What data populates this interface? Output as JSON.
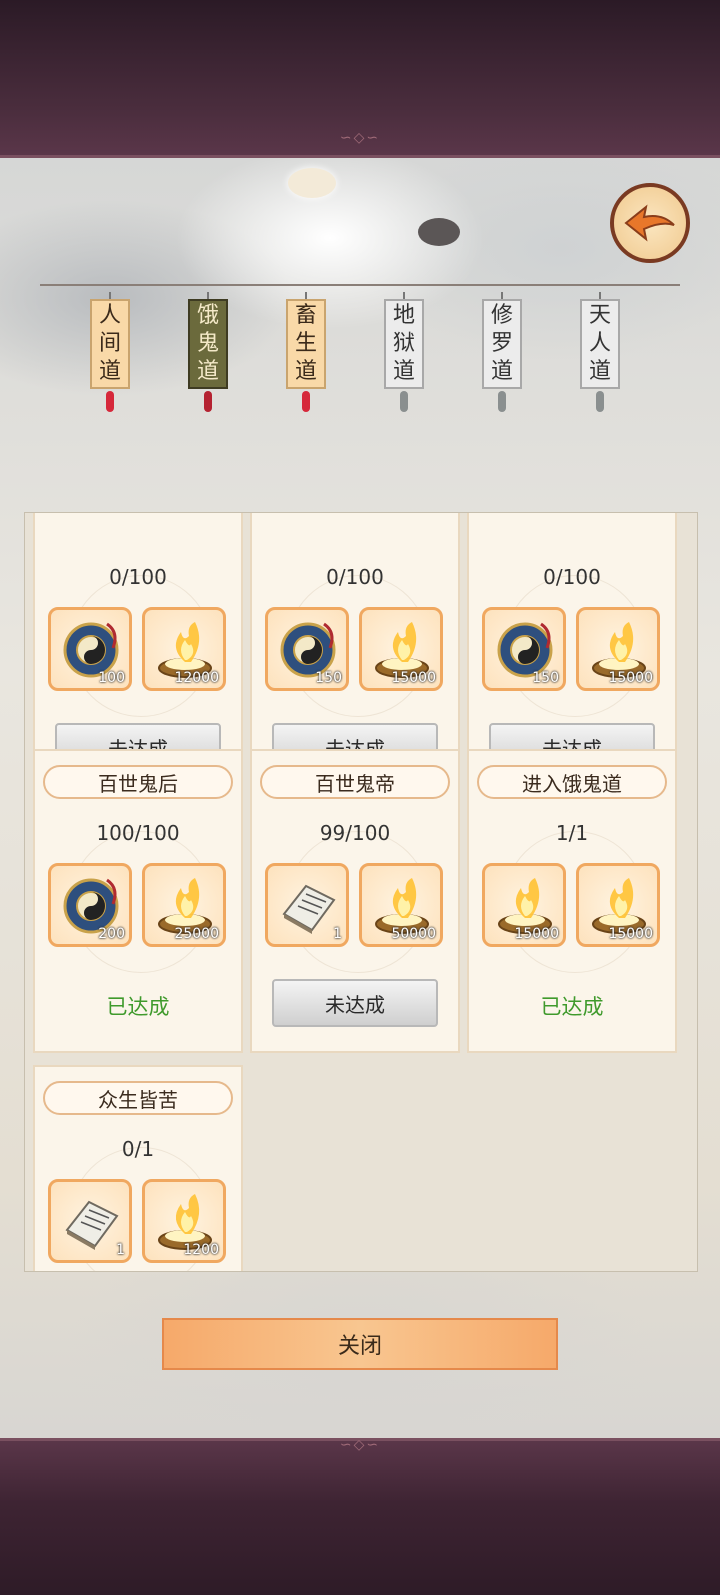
{
  "tabs": [
    {
      "label": "人间道",
      "state": "normal"
    },
    {
      "label": "饿鬼道",
      "state": "active"
    },
    {
      "label": "畜生道",
      "state": "normal"
    },
    {
      "label": "地狱道",
      "state": "locked"
    },
    {
      "label": "修罗道",
      "state": "locked"
    },
    {
      "label": "天人道",
      "state": "locked"
    }
  ],
  "cards": [
    {
      "title": "",
      "progress": "0/100",
      "items": [
        {
          "icon": "bagua-icon",
          "count": "100"
        },
        {
          "icon": "incense-burner-icon",
          "count": "12000"
        }
      ],
      "status": "未达成",
      "done": false
    },
    {
      "title": "",
      "progress": "0/100",
      "items": [
        {
          "icon": "bagua-icon",
          "count": "150"
        },
        {
          "icon": "incense-burner-icon",
          "count": "15000"
        }
      ],
      "status": "未达成",
      "done": false
    },
    {
      "title": "",
      "progress": "0/100",
      "items": [
        {
          "icon": "bagua-icon",
          "count": "150"
        },
        {
          "icon": "incense-burner-icon",
          "count": "15000"
        }
      ],
      "status": "未达成",
      "done": false
    },
    {
      "title": "百世鬼后",
      "progress": "100/100",
      "items": [
        {
          "icon": "bagua-icon",
          "count": "200"
        },
        {
          "icon": "incense-burner-icon",
          "count": "25000"
        }
      ],
      "status": "已达成",
      "done": true
    },
    {
      "title": "百世鬼帝",
      "progress": "99/100",
      "items": [
        {
          "icon": "scroll-book-icon",
          "count": "1"
        },
        {
          "icon": "incense-burner-icon",
          "count": "50000"
        }
      ],
      "status": "未达成",
      "done": false
    },
    {
      "title": "进入饿鬼道",
      "progress": "1/1",
      "items": [
        {
          "icon": "incense-burner-icon",
          "count": "15000"
        },
        {
          "icon": "incense-burner-icon",
          "count": "15000"
        }
      ],
      "status": "已达成",
      "done": true
    },
    {
      "title": "众生皆苦",
      "progress": "0/1",
      "items": [
        {
          "icon": "scroll-book-icon",
          "count": "1"
        },
        {
          "icon": "incense-burner-icon",
          "count": "1200"
        }
      ],
      "status": "",
      "done": false
    }
  ],
  "close_label": "关闭",
  "colors": {
    "done": "#3f9a2c",
    "item_border": "#f0a860"
  }
}
